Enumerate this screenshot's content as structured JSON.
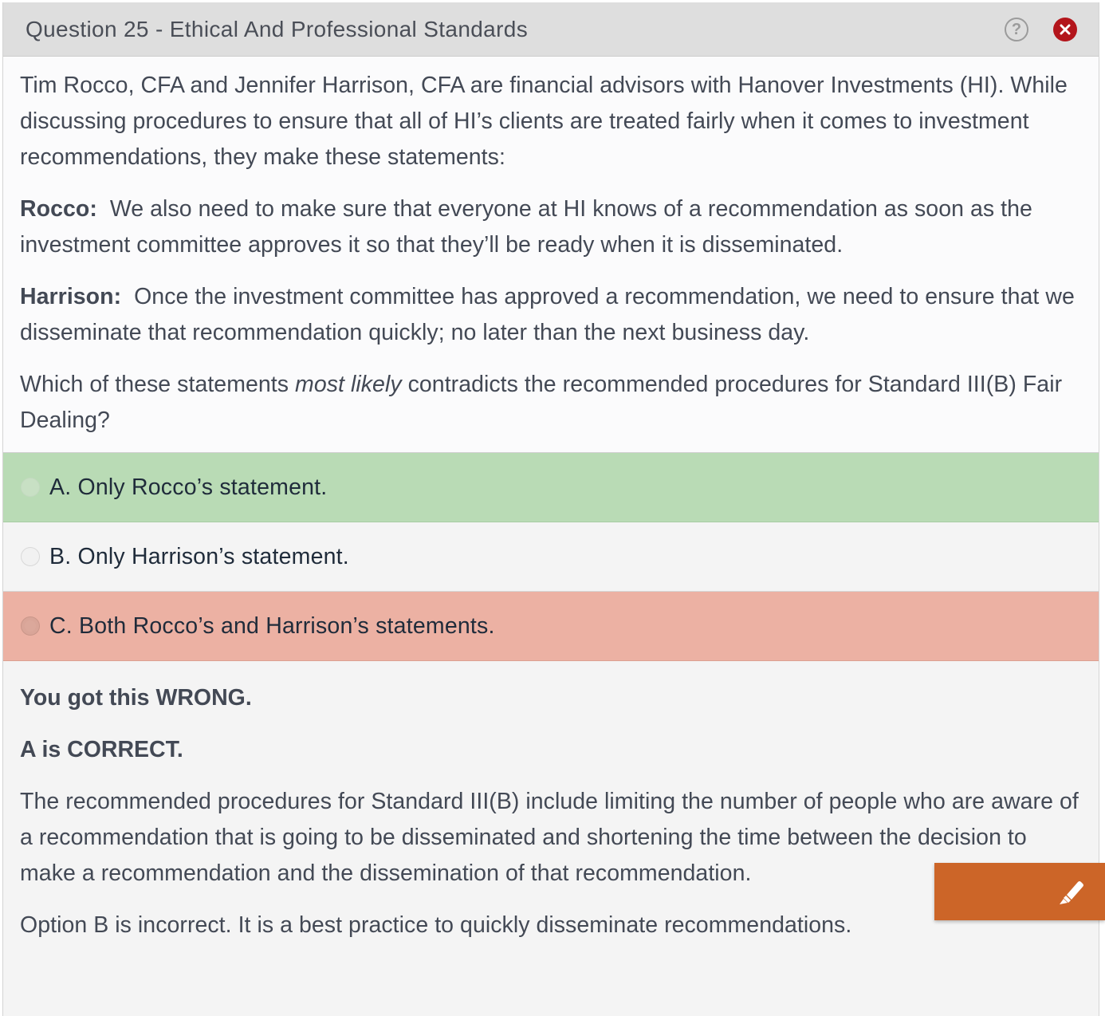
{
  "dialog": {
    "title": "Question 25 - Ethical And Professional Standards",
    "help_label": "?"
  },
  "question": {
    "intro": "Tim Rocco, CFA and Jennifer Harrison, CFA are financial advisors with Hanover Investments (HI).  While discussing procedures to ensure that all of HI’s clients are treated fairly when it comes to investment recommendations, they make these statements:",
    "statements": [
      {
        "speaker": "Rocco:",
        "text": "We also need to make sure that everyone at HI knows of a recommendation as soon as the investment committee approves it so that they’ll be ready when it is disseminated."
      },
      {
        "speaker": "Harrison:",
        "text": "Once the investment committee has approved a recommendation, we need to ensure that we disseminate that recommendation quickly; no later than the next business day."
      }
    ],
    "prompt_before": "Which of these statements ",
    "prompt_emphasis": "most likely",
    "prompt_after": " contradicts the recommended procedures for Standard III(B) Fair Dealing?"
  },
  "options": [
    {
      "letter": "A.",
      "text": "Only Rocco’s statement.",
      "state": "correct"
    },
    {
      "letter": "B.",
      "text": "Only Harrison’s statement.",
      "state": "neutral"
    },
    {
      "letter": "C.",
      "text": "Both Rocco’s and Harrison’s statements.",
      "state": "wrong-selected"
    }
  ],
  "explanation": {
    "result": "You got this WRONG.",
    "correct_answer": "A is CORRECT.",
    "body": "The recommended procedures for Standard III(B) include limiting the number of people who are aware of a recommendation that is going to be disseminated and shortening the time between the decision to make a recommendation and the dissemination of that recommendation.",
    "option_b_note": "Option B is incorrect.  It is a best practice to quickly disseminate recommendations."
  },
  "colors": {
    "correct": "#b9dbb5",
    "wrong": "#ecb1a3",
    "highlight_button": "#cc6528",
    "close": "#b3151b"
  },
  "icons": {
    "help": "help-circle-icon",
    "close": "close-circle-icon",
    "highlighter": "highlighter-icon"
  }
}
